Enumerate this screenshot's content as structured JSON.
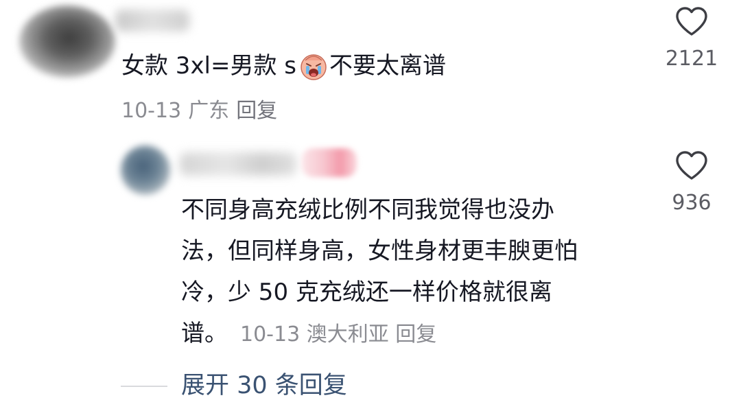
{
  "comments": [
    {
      "text_before_emoji": "女款 3xl=男款 s",
      "emoji": "crying-face-emoji",
      "text_after_emoji": "不要太离谱",
      "date": "10-13",
      "location": "广东",
      "reply_label": "回复",
      "like_count": "2121"
    },
    {
      "lines": [
        "不同身高充绒比例不同我觉得也没办",
        "法，但同样身高，女性身材更丰腴更怕",
        "冷，少 50 克充绒还一样价格就很离",
        "谱。"
      ],
      "date": "10-13",
      "location": "澳大利亚",
      "reply_label": "回复",
      "like_count": "936"
    }
  ],
  "expand_replies_label": "展开 30 条回复",
  "colors": {
    "text": "#161823",
    "meta": "#8a8b91",
    "like_count": "#5b5c63",
    "expand_link": "#3a5272",
    "heart_outline": "#3d3e44"
  }
}
